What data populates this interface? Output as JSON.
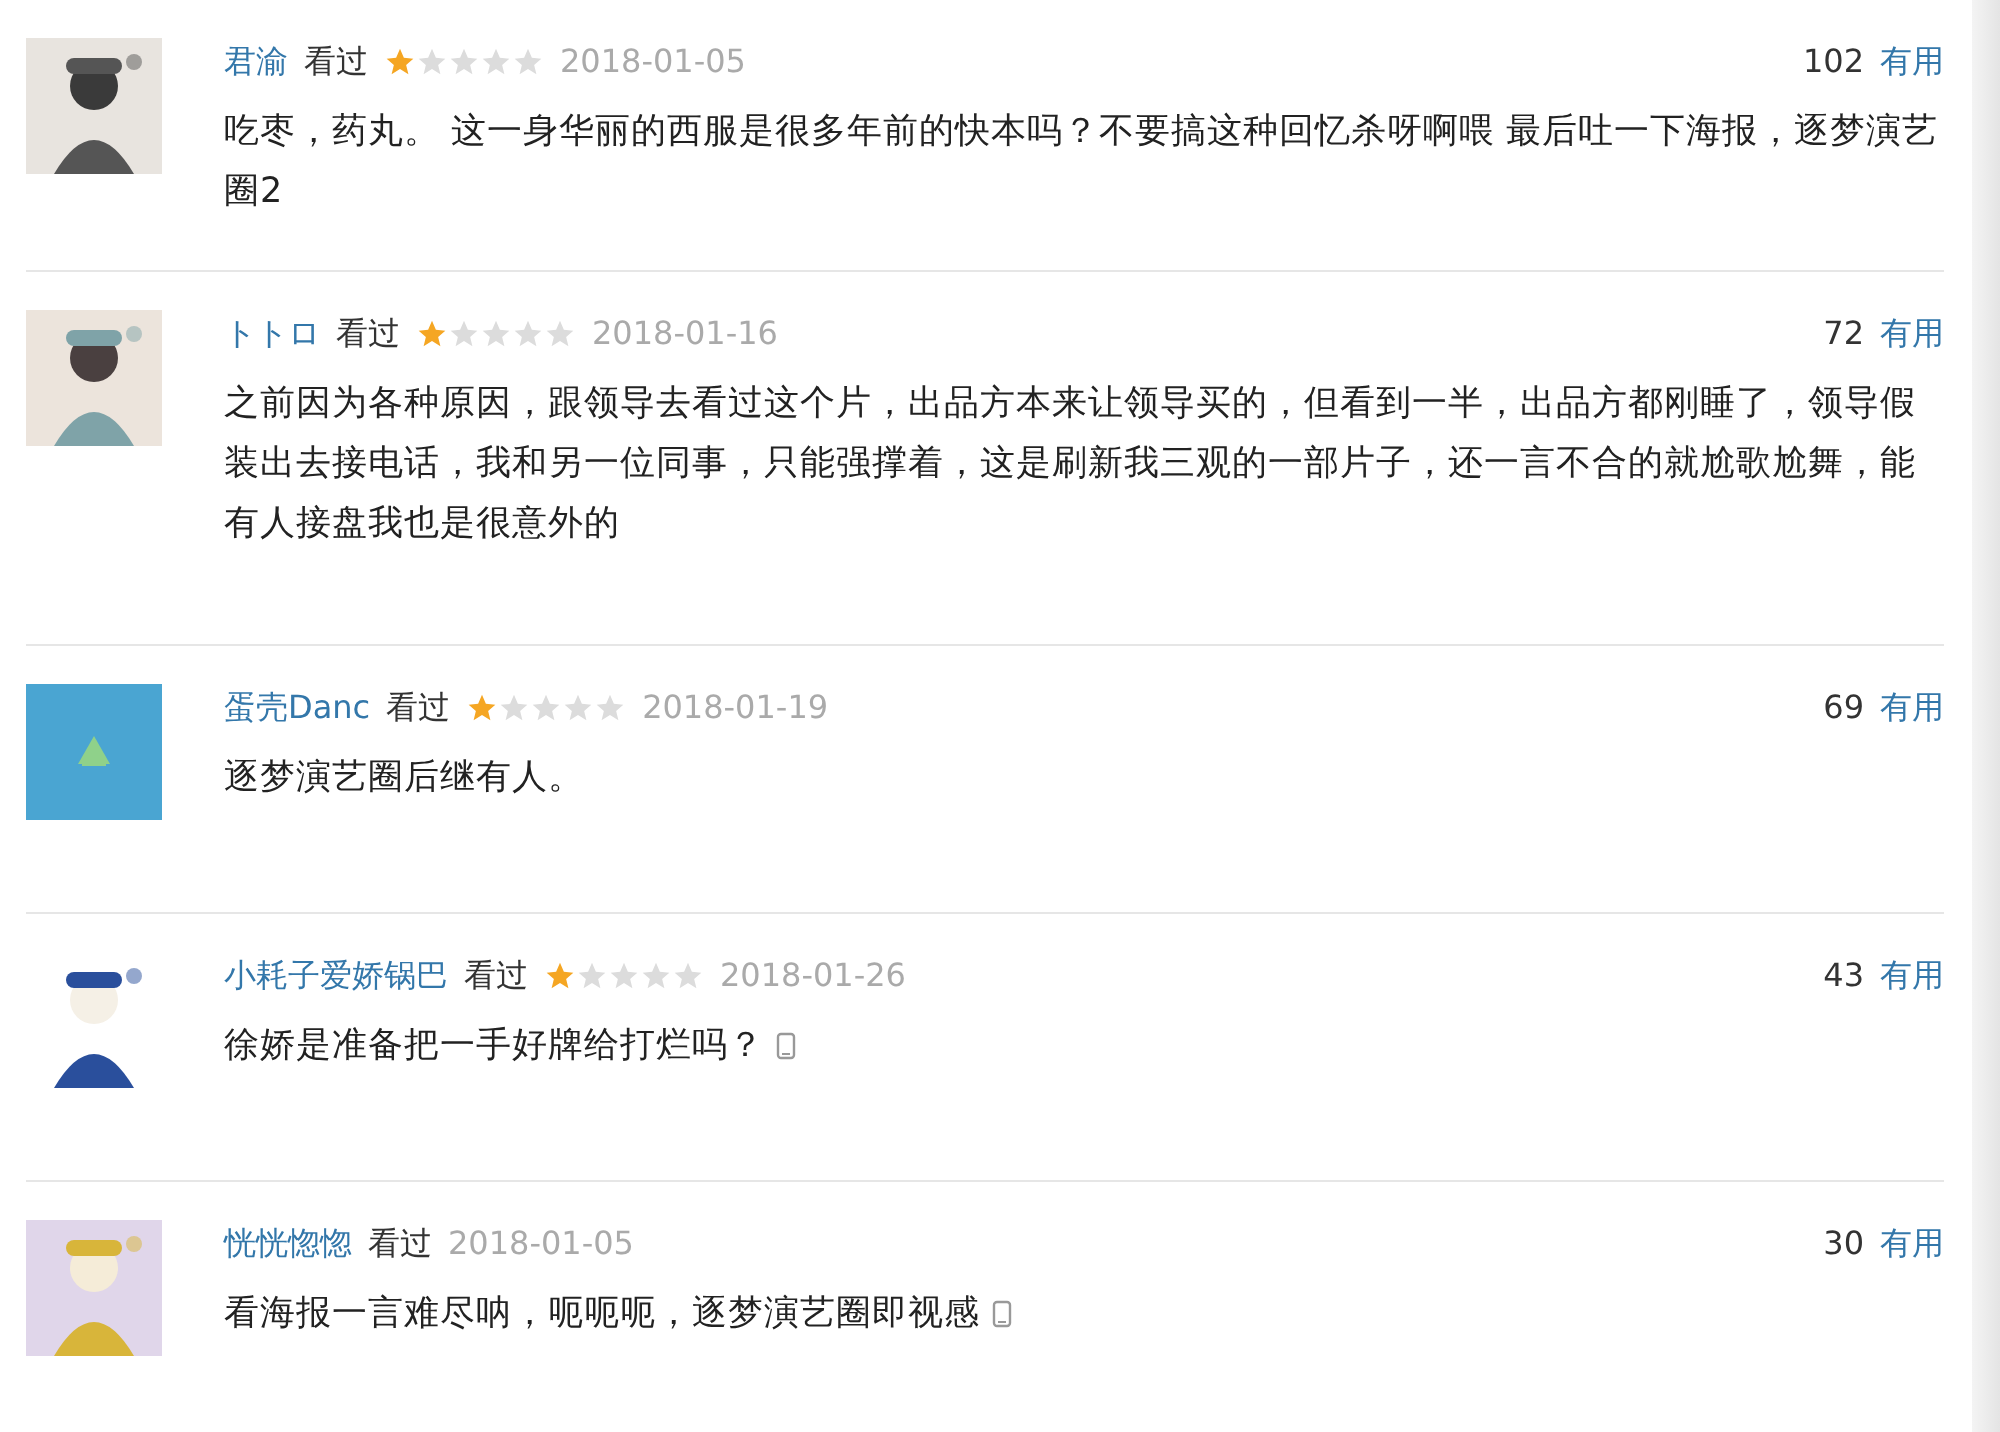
{
  "comments": [
    {
      "user": "君渝",
      "status": "看过",
      "stars": 1,
      "date": "2018-01-05",
      "votes": "102",
      "vote_label": "有用",
      "text": "吃枣，药丸。 这一身华丽的西服是很多年前的快本吗？不要搞这种回忆杀呀啊喂 最后吐一下海报，逐梦演艺圈2",
      "mobile": false
    },
    {
      "user": "トトロ",
      "status": "看过",
      "stars": 1,
      "date": "2018-01-16",
      "votes": "72",
      "vote_label": "有用",
      "text": "之前因为各种原因，跟领导去看过这个片，出品方本来让领导买的，但看到一半，出品方都刚睡了，领导假装出去接电话，我和另一位同事，只能强撑着，这是刷新我三观的一部片子，还一言不合的就尬歌尬舞，能有人接盘我也是很意外的",
      "mobile": false
    },
    {
      "user": "蛋壳Danc",
      "status": "看过",
      "stars": 1,
      "date": "2018-01-19",
      "votes": "69",
      "vote_label": "有用",
      "text": "逐梦演艺圈后继有人。",
      "mobile": false
    },
    {
      "user": "小耗子爱娇锅巴",
      "status": "看过",
      "stars": 1,
      "date": "2018-01-26",
      "votes": "43",
      "vote_label": "有用",
      "text": "徐娇是准备把一手好牌给打烂吗？",
      "mobile": true
    },
    {
      "user": "恍恍惚惚",
      "status": "看过",
      "date": "2018-01-05",
      "votes": "30",
      "vote_label": "有用",
      "text": "看海报一言难尽呐，呃呃呃，逐梦演艺圈即视感",
      "mobile": true
    }
  ]
}
